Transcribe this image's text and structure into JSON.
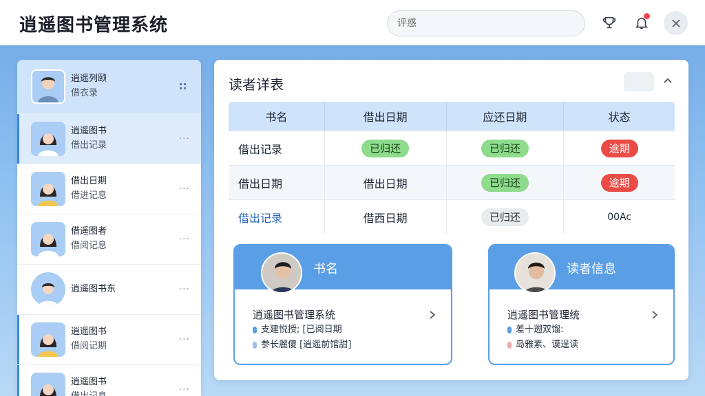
{
  "app": {
    "title": "逍遥图书管理系统"
  },
  "search": {
    "placeholder": "评惑"
  },
  "sidebar": {
    "items": [
      {
        "name": "逍遥列颐",
        "sub": "借衣录"
      },
      {
        "name": "逍遥图书",
        "sub": "借出记录"
      },
      {
        "name": "借出日期",
        "sub": "借进记息"
      },
      {
        "name": "借遥图者",
        "sub": "借阅记息"
      },
      {
        "name": "逍遥图书东",
        "sub": ""
      },
      {
        "name": "逍遥图书",
        "sub": "借阅记期"
      },
      {
        "name": "逍遥图书",
        "sub": "借出记息"
      }
    ],
    "more_glyph": "···"
  },
  "main": {
    "title": "读者详表",
    "table": {
      "headers": [
        "书名",
        "借出日期",
        "应还日期",
        "状态"
      ],
      "rows": [
        {
          "title": "借出记录",
          "borrowed": "已归还",
          "due": "已归还",
          "status": "逾期"
        },
        {
          "title": "借出日期",
          "borrowed": "借出日期",
          "due": "已归还",
          "status": "逾期"
        },
        {
          "title": "借出记录",
          "borrowed": "借西日期",
          "due": "已归还",
          "status": "00Ac"
        }
      ]
    },
    "cards": [
      {
        "title": "书名",
        "line1": "逍遥图书管理系统",
        "line2": "支建悦授; [已阅日期",
        "line3": "参长麗傻 [逍遥前馆甜]"
      },
      {
        "title": "读者信息",
        "line1": "逍遥图书管理统",
        "line2": "差十遡双馏:",
        "line3": "岛雅素、谟逞读"
      }
    ]
  },
  "colors": {
    "accent": "#5a9fe6",
    "green_pill": "#8fdb8c",
    "red_pill": "#ea4b47"
  }
}
